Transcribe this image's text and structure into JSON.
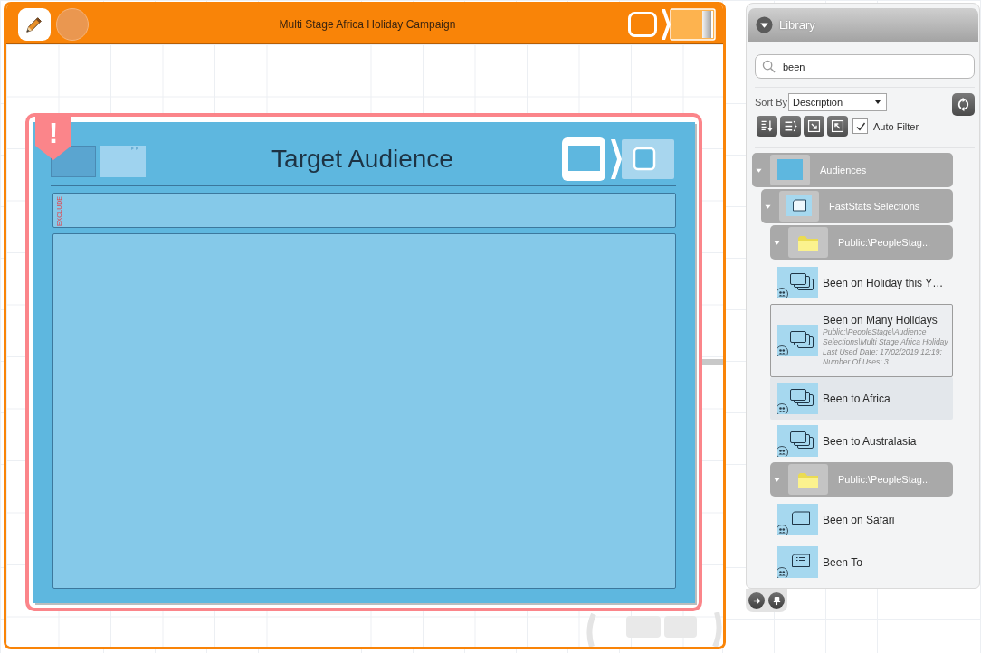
{
  "campaign": {
    "title": "Multi Stage Africa Holiday Campaign"
  },
  "stage": {
    "title": "Target Audience",
    "warning": "!",
    "exclude_label": "EXCLUDE"
  },
  "library": {
    "title": "Library",
    "search": {
      "value": "been"
    },
    "sort": {
      "label": "Sort By",
      "value": "Description"
    },
    "auto_filter": {
      "label": "Auto Filter",
      "checked": true
    },
    "tree": [
      {
        "label": "Audiences",
        "kind": "category",
        "expanded": true,
        "children": [
          {
            "label": "FastStats Selections",
            "kind": "selections",
            "expanded": true,
            "children": [
              {
                "label": "Public:\\PeopleStag...",
                "kind": "folder",
                "expanded": true,
                "children": [
                  {
                    "label": "Been on Holiday this Y…",
                    "kind": "stacked",
                    "selected": false,
                    "hovered": false
                  },
                  {
                    "label": "Been on Many Holidays",
                    "kind": "stacked",
                    "selected": true,
                    "hovered": false,
                    "details": [
                      "Public:\\PeopleStage\\Audience Selections\\Multi Stage Africa Holiday",
                      "Last Used Date: 17/02/2019 12:19:",
                      "Number Of Uses: 3"
                    ]
                  },
                  {
                    "label": "Been to Africa",
                    "kind": "stacked",
                    "selected": false,
                    "hovered": true
                  },
                  {
                    "label": "Been to Australasia",
                    "kind": "stacked",
                    "selected": false,
                    "hovered": false
                  }
                ]
              },
              {
                "label": "Public:\\PeopleStag...",
                "kind": "folder",
                "expanded": true,
                "children": [
                  {
                    "label": "Been on Safari",
                    "kind": "single",
                    "selected": false,
                    "hovered": false
                  },
                  {
                    "label": "Been To",
                    "kind": "list",
                    "selected": false,
                    "hovered": false
                  }
                ]
              }
            ]
          }
        ]
      }
    ]
  }
}
